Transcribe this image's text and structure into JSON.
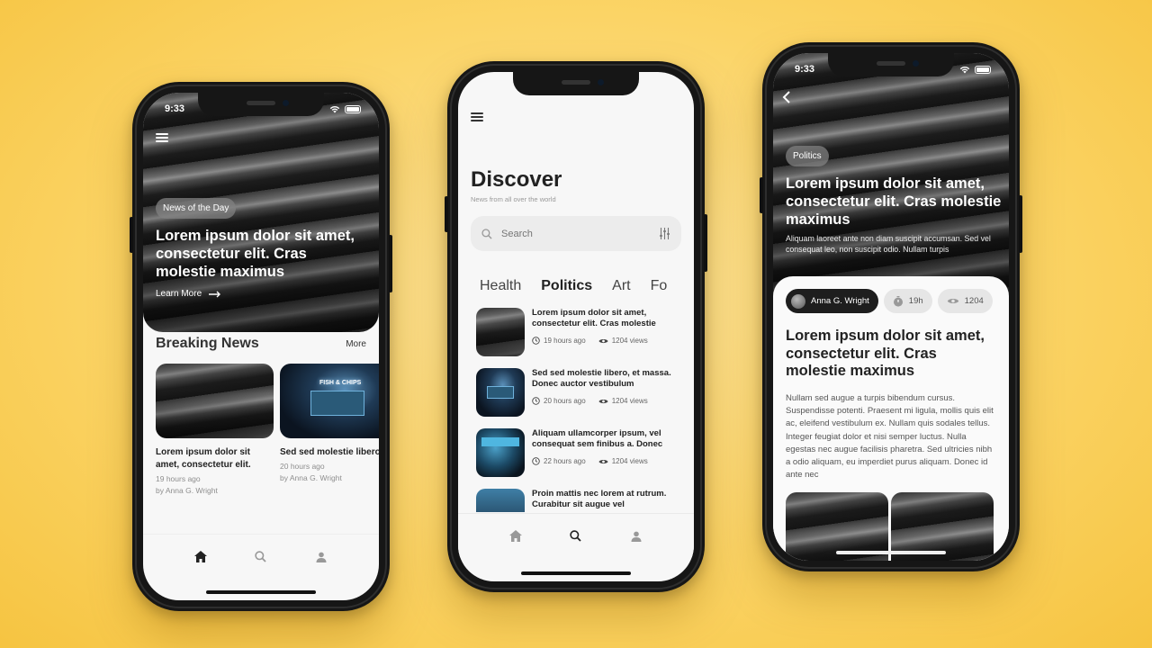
{
  "status_time_1": "9:33",
  "status_time_3": "9:33",
  "home": {
    "chip": "News of the Day",
    "headline": "Lorem ipsum dolor sit amet, consectetur elit. Cras molestie maximus",
    "learn_more": "Learn More",
    "breaking_title": "Breaking News",
    "more": "More",
    "cards": [
      {
        "title": "Lorem ipsum dolor sit amet, consectetur elit.",
        "time": "19 hours ago",
        "author": "by Anna G. Wright"
      },
      {
        "title": "Sed sed molestie libero, et massa. Donec auctor",
        "time": "20 hours ago",
        "author": "by Anna G. Wright"
      }
    ],
    "sign_text": "FISH & CHIPS"
  },
  "discover": {
    "title": "Discover",
    "subtitle": "News from all over the world",
    "search_placeholder": "Search",
    "categories": [
      "Health",
      "Politics",
      "Art",
      "Fo"
    ],
    "active_category": "Politics",
    "items": [
      {
        "title": "Lorem ipsum dolor sit amet, consectetur elit. Cras molestie",
        "time": "19 hours ago",
        "views": "1204 views"
      },
      {
        "title": "Sed sed molestie libero, et massa. Donec auctor vestibulum",
        "time": "20 hours ago",
        "views": "1204 views"
      },
      {
        "title": "Aliquam ullamcorper ipsum, vel consequat sem finibus a. Donec",
        "time": "22 hours ago",
        "views": "1204 views"
      },
      {
        "title": "Proin mattis nec lorem at rutrum. Curabitur sit augue vel",
        "time": "",
        "views": ""
      }
    ]
  },
  "article": {
    "category": "Politics",
    "headline": "Lorem ipsum dolor sit amet, consectetur elit. Cras molestie maximus",
    "summary": "Aliquam laoreet ante non diam suscipit accumsan. Sed vel consequat leo, non suscipit odio. Nullam turpis",
    "author": "Anna G. Wright",
    "time": "19h",
    "views": "1204",
    "title": "Lorem ipsum dolor sit amet, consectetur elit. Cras molestie maximus",
    "body": "Nullam sed augue a turpis bibendum cursus. Suspendisse potenti. Praesent mi ligula, mollis quis elit ac, eleifend vestibulum ex. Nullam quis sodales tellus. Integer feugiat dolor et nisi semper luctus. Nulla egestas nec augue facilisis pharetra. Sed ultricies nibh a odio aliquam, eu imperdiet purus aliquam. Donec id ante nec"
  },
  "colors": {
    "background": "#fbd466",
    "dark": "#222222",
    "chip_bg": "#8a8a8a",
    "light_bg": "#f7f7f7"
  }
}
